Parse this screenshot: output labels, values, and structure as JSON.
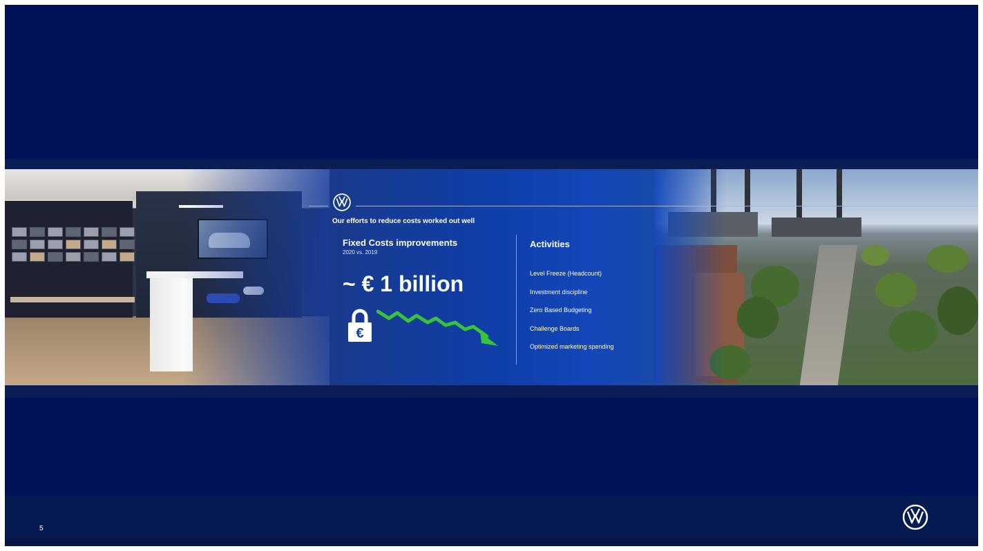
{
  "slide": {
    "headline": "Our efforts to reduce costs worked out well",
    "page_number": "5",
    "background_color": "#001257"
  },
  "fixed_costs": {
    "title": "Fixed Costs improvements",
    "subtitle": "2020 vs. 2019",
    "figure": "~ € 1 billion",
    "lock_symbol": "€",
    "trend_color": "#36c43a"
  },
  "activities": {
    "title": "Activities",
    "items": [
      "Level Freeze (Headcount)",
      "Investment discipline",
      "Zero Based Budgeting",
      "Challenge Boards",
      "Optimized marketing spending"
    ]
  },
  "icons": {
    "header_logo": "vw-logo-icon",
    "footer_logo": "vw-logo-icon",
    "lock": "euro-padlock-icon",
    "trend": "downward-trend-arrow-icon"
  },
  "images": {
    "left": "showroom-photo",
    "right": "factory-aerial-photo"
  }
}
